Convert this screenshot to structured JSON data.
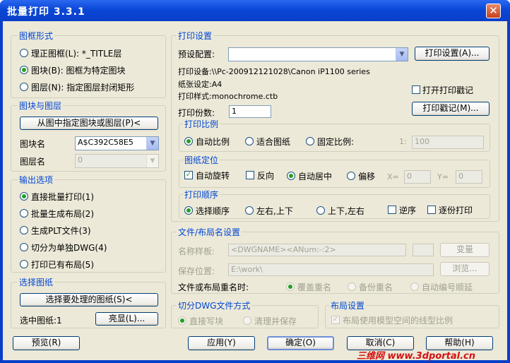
{
  "window": {
    "title": "批量打印 3.3.1",
    "close_symbol": "✕"
  },
  "frame_type": {
    "title": "图框形式",
    "opt1": "理正图框(L): *_TITLE层",
    "opt2": "图块(B): 图框为特定图块",
    "opt3": "图层(N): 指定图层封闭矩形",
    "selected": 2
  },
  "block_layer": {
    "title": "图块与图层",
    "pick_button": "从图中指定图块或图层(P)<",
    "block_label": "图块名",
    "block_value": "A$C392C58E5",
    "layer_label": "图层名",
    "layer_value": "0"
  },
  "output": {
    "title": "输出选项",
    "opt1": "直接批量打印(1)",
    "opt2": "批量生成布局(2)",
    "opt3": "生成PLT文件(3)",
    "opt4": "切分为单独DWG(4)",
    "opt5": "打印已有布局(5)",
    "selected": 1
  },
  "select": {
    "title": "选择图纸",
    "select_button": "选择要处理的图纸(S)<",
    "count_text": "选中图纸:1",
    "highlight_button": "亮显(L)..."
  },
  "print_settings": {
    "title": "打印设置",
    "preset_label": "预设配置:",
    "preset_value": "",
    "setup_button": "打印设置(A)...",
    "device_text": "打印设备:\\\\Pc-200912121028\\Canon iP1100 series",
    "paper_text": "纸张设定:A4",
    "style_text": "打印样式:monochrome.ctb",
    "stamp_check": "打开打印戳记",
    "stamp_checked": false,
    "copies_label": "打印份数:",
    "copies_value": "1",
    "stamp_button": "打印戳记(M)..."
  },
  "scale": {
    "title": "打印比例",
    "auto": "自动比例",
    "fit": "适合图纸",
    "fixed": "固定比例:",
    "ratio_prefix": "1:",
    "ratio_value": "100",
    "selected": "auto"
  },
  "position": {
    "title": "图纸定位",
    "auto_rotate": "自动旋转",
    "auto_rotate_checked": true,
    "reverse": "反向",
    "reverse_checked": false,
    "center": "自动居中",
    "offset": "偏移",
    "x_label": "X=",
    "x_value": "0",
    "y_label": "Y=",
    "y_value": "0",
    "selected": "center"
  },
  "order": {
    "title": "打印顺序",
    "select_order": "选择顺序",
    "lr_tb": "左右,上下",
    "tb_lr": "上下,左右",
    "reverse": "逆序",
    "per_copy": "逐份打印",
    "selected": "select_order"
  },
  "filename": {
    "title": "文件/布局名设置",
    "template_label": "名称样板:",
    "template_value": "<DWGNAME><ANum:-:2>",
    "variable_button": "变量",
    "save_label": "保存位置:",
    "save_value": "E:\\work\\",
    "browse_button": "浏览...",
    "dup_label": "文件或布局重名时:",
    "overwrite": "覆盖重名",
    "backup": "备份重名",
    "autonum": "自动编号顺延"
  },
  "split": {
    "title": "切分DWG文件方式",
    "direct": "直接写块",
    "clean": "清理并保存"
  },
  "layout": {
    "title": "布局设置",
    "linetype": "布局使用模型空间的线型比例"
  },
  "footer": {
    "preview": "预览(R)",
    "apply": "应用(Y)",
    "ok": "确定(O)",
    "cancel": "取消(C)",
    "help": "帮助(H)"
  },
  "watermark": "三维网 www.3dportal.cn",
  "colors": {
    "title_bar": "#0a47d6",
    "group_title": "#0046d5",
    "dialog_bg": "#ece9d8"
  }
}
